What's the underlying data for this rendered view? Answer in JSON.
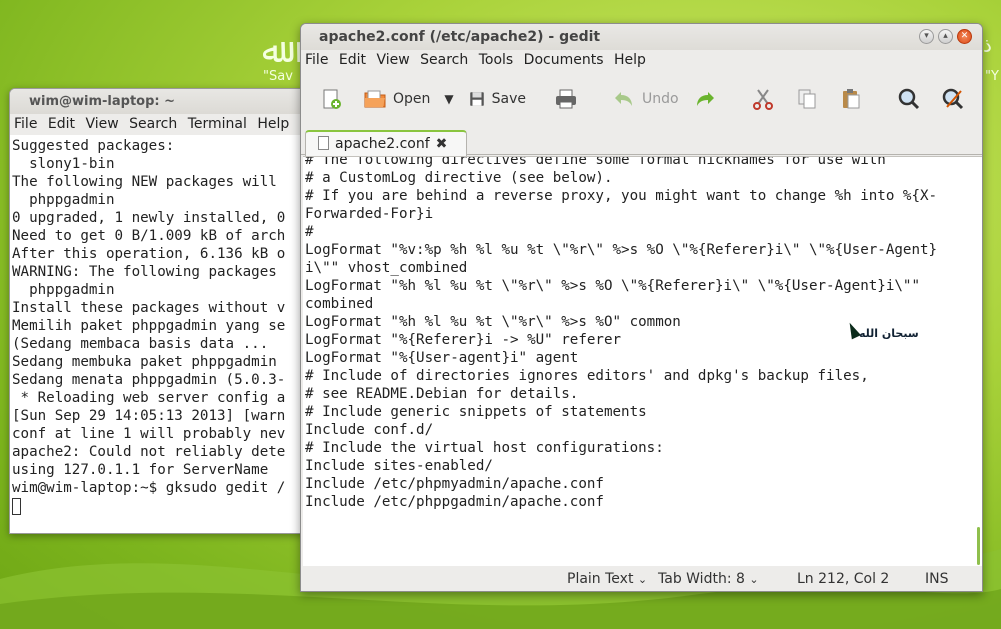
{
  "desktop": {
    "left_caption": "\"Sav",
    "right_caption": "\"Y"
  },
  "terminal": {
    "title": "wim@wim-laptop: ~",
    "menu": [
      "File",
      "Edit",
      "View",
      "Search",
      "Terminal",
      "Help"
    ],
    "lines": [
      "Suggested packages:",
      "  slony1-bin",
      "The following NEW packages will",
      "  phppgadmin",
      "0 upgraded, 1 newly installed, 0",
      "Need to get 0 B/1.009 kB of arch",
      "After this operation, 6.136 kB o",
      "WARNING: The following packages",
      "  phppgadmin",
      "Install these packages without v",
      "Memilih paket phppgadmin yang se",
      "(Sedang membaca basis data ...",
      "Sedang membuka paket phppgadmin",
      "Sedang menata phppgadmin (5.0.3-",
      " * Reloading web server config a",
      "[Sun Sep 29 14:05:13 2013] [warn",
      "conf at line 1 will probably nev",
      "apache2: Could not reliably dete",
      "using 127.0.1.1 for ServerName",
      "",
      "wim@wim-laptop:~$ gksudo gedit /"
    ]
  },
  "gedit": {
    "title": "apache2.conf (/etc/apache2) - gedit",
    "menu": [
      "File",
      "Edit",
      "View",
      "Search",
      "Tools",
      "Documents",
      "Help"
    ],
    "toolbar": {
      "open": "Open",
      "save": "Save",
      "undo": "Undo"
    },
    "tab_label": "apache2.conf",
    "code_lines": [
      "# The following directives define some format nicknames for use with",
      "# a CustomLog directive (see below).",
      "# If you are behind a reverse proxy, you might want to change %h into %{X-",
      "Forwarded-For}i",
      "#",
      "LogFormat \"%v:%p %h %l %u %t \\\"%r\\\" %>s %O \\\"%{Referer}i\\\" \\\"%{User-Agent}",
      "i\\\"\" vhost_combined",
      "LogFormat \"%h %l %u %t \\\"%r\\\" %>s %O \\\"%{Referer}i\\\" \\\"%{User-Agent}i\\\"\"",
      "combined",
      "LogFormat \"%h %l %u %t \\\"%r\\\" %>s %O\" common",
      "LogFormat \"%{Referer}i -> %U\" referer",
      "LogFormat \"%{User-agent}i\" agent",
      "",
      "# Include of directories ignores editors' and dpkg's backup files,",
      "# see README.Debian for details.",
      "",
      "# Include generic snippets of statements",
      "Include conf.d/",
      "",
      "# Include the virtual host configurations:",
      "Include sites-enabled/",
      "Include /etc/phpmyadmin/apache.conf",
      "Include /etc/phppgadmin/apache.conf"
    ],
    "overlay_text": "سبحان الله",
    "status": {
      "language": "Plain Text",
      "tab_width": "Tab Width:  8",
      "position": "Ln 212, Col 2",
      "mode": "INS"
    }
  }
}
